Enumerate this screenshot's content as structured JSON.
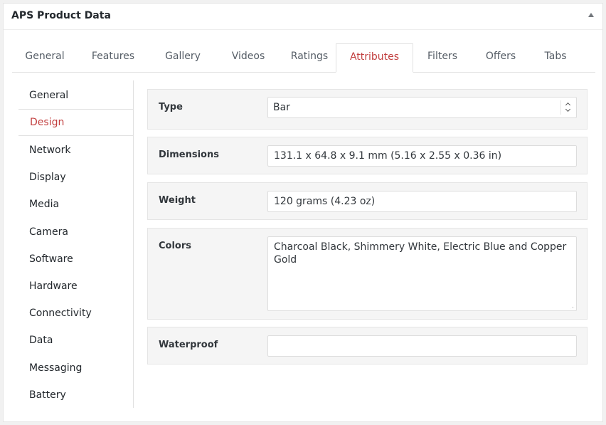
{
  "metabox": {
    "title": "APS Product Data"
  },
  "tabs": [
    {
      "label": "General",
      "active": false
    },
    {
      "label": "Features",
      "active": false
    },
    {
      "label": "Gallery",
      "active": false
    },
    {
      "label": "Videos",
      "active": false
    },
    {
      "label": "Ratings",
      "active": false
    },
    {
      "label": "Attributes",
      "active": true
    },
    {
      "label": "Filters",
      "active": false
    },
    {
      "label": "Offers",
      "active": false
    },
    {
      "label": "Tabs",
      "active": false
    }
  ],
  "sidenav": [
    {
      "label": "General",
      "active": false
    },
    {
      "label": "Design",
      "active": true
    },
    {
      "label": "Network",
      "active": false
    },
    {
      "label": "Display",
      "active": false
    },
    {
      "label": "Media",
      "active": false
    },
    {
      "label": "Camera",
      "active": false
    },
    {
      "label": "Software",
      "active": false
    },
    {
      "label": "Hardware",
      "active": false
    },
    {
      "label": "Connectivity",
      "active": false
    },
    {
      "label": "Data",
      "active": false
    },
    {
      "label": "Messaging",
      "active": false
    },
    {
      "label": "Battery",
      "active": false
    }
  ],
  "fields": {
    "type": {
      "label": "Type",
      "value": "Bar"
    },
    "dimensions": {
      "label": "Dimensions",
      "value": "131.1 x 64.8 x 9.1 mm (5.16 x 2.55 x 0.36 in)"
    },
    "weight": {
      "label": "Weight",
      "value": "120 grams  (4.23 oz)"
    },
    "colors": {
      "label": "Colors",
      "value": "Charcoal Black, Shimmery White, Electric Blue and Copper Gold"
    },
    "waterproof": {
      "label": "Waterproof",
      "value": ""
    }
  },
  "colors": {
    "accent": "#c23f3f",
    "text": "#23282d",
    "border": "#e1e1e1",
    "row_background": "#f5f5f5"
  },
  "icons": {
    "toggle": "triangle-up-icon",
    "select": "select-arrows-icon",
    "resize": "resize-grip-icon"
  }
}
